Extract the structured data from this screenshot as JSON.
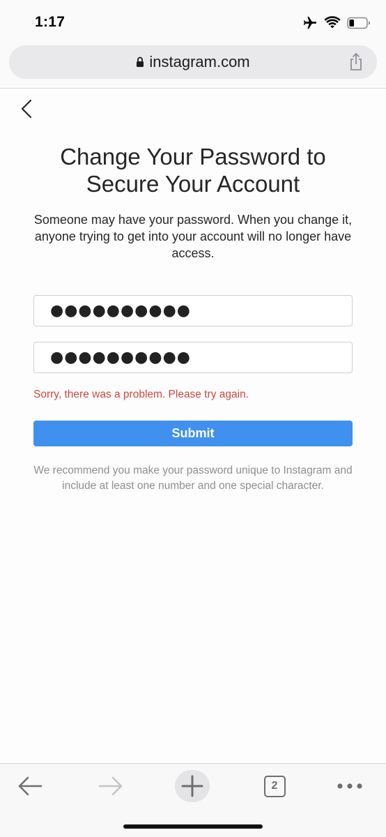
{
  "status_bar": {
    "time": "1:17",
    "icons": [
      "airplane-icon",
      "wifi-icon",
      "battery-icon"
    ]
  },
  "browser": {
    "url": "instagram.com",
    "lock_icon": "lock-icon",
    "share_icon": "share-icon"
  },
  "page": {
    "title": "Change Your Password to Secure Your Account",
    "subtitle": "Someone may have your password. When you change it, anyone trying to get into your account will no longer have access.",
    "new_password_value": "●●●●●●●●●●",
    "confirm_password_value": "●●●●●●●●●●",
    "error_message": "Sorry, there was a problem. Please try again.",
    "submit_label": "Submit",
    "hint": "We recommend you make your password unique to Instagram and include at least one number and one special character."
  },
  "toolbar": {
    "tab_count": "2",
    "icons": [
      "back-arrow-icon",
      "forward-arrow-icon",
      "plus-icon",
      "tabs-icon",
      "more-icon"
    ]
  },
  "colors": {
    "accent": "#4090ef",
    "error": "#d0463f",
    "hint": "#8e8e8e"
  }
}
